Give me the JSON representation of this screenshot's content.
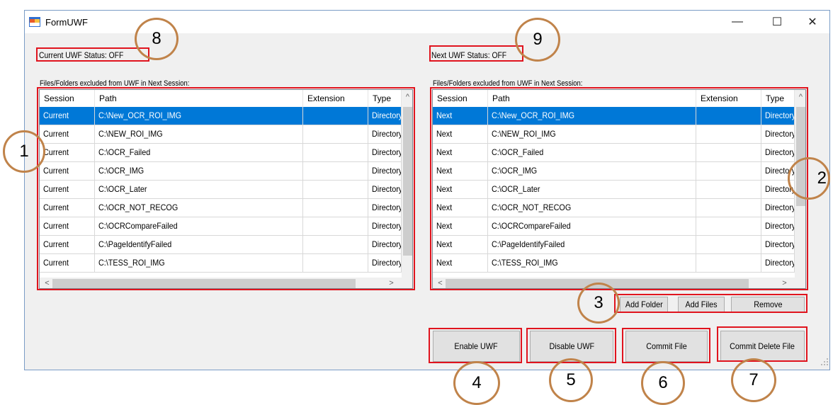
{
  "window": {
    "title": "FormUWF",
    "minimize": "—",
    "maximize": "☐",
    "close": "✕"
  },
  "left": {
    "status": "Current UWF Status: OFF",
    "list_label": "Files/Folders excluded from UWF in Next Session:",
    "columns": [
      "Session",
      "Path",
      "Extension",
      "Type"
    ],
    "rows": [
      [
        "Current",
        "C:\\New_OCR_ROI_IMG",
        "",
        "Directory"
      ],
      [
        "Current",
        "C:\\NEW_ROI_IMG",
        "",
        "Directory"
      ],
      [
        "Current",
        "C:\\OCR_Failed",
        "",
        "Directory"
      ],
      [
        "Current",
        "C:\\OCR_IMG",
        "",
        "Directory"
      ],
      [
        "Current",
        "C:\\OCR_Later",
        "",
        "Directory"
      ],
      [
        "Current",
        "C:\\OCR_NOT_RECOG",
        "",
        "Directory"
      ],
      [
        "Current",
        "C:\\OCRCompareFailed",
        "",
        "Directory"
      ],
      [
        "Current",
        "C:\\PageIdentifyFailed",
        "",
        "Directory"
      ],
      [
        "Current",
        "C:\\TESS_ROI_IMG",
        "",
        "Directory"
      ]
    ],
    "selected_index": 0
  },
  "right": {
    "status": "Next UWF Status: OFF",
    "list_label": "Files/Folders excluded from UWF in Next Session:",
    "columns": [
      "Session",
      "Path",
      "Extension",
      "Type"
    ],
    "rows": [
      [
        "Next",
        "C:\\New_OCR_ROI_IMG",
        "",
        "Directory"
      ],
      [
        "Next",
        "C:\\NEW_ROI_IMG",
        "",
        "Directory"
      ],
      [
        "Next",
        "C:\\OCR_Failed",
        "",
        "Directory"
      ],
      [
        "Next",
        "C:\\OCR_IMG",
        "",
        "Directory"
      ],
      [
        "Next",
        "C:\\OCR_Later",
        "",
        "Directory"
      ],
      [
        "Next",
        "C:\\OCR_NOT_RECOG",
        "",
        "Directory"
      ],
      [
        "Next",
        "C:\\OCRCompareFailed",
        "",
        "Directory"
      ],
      [
        "Next",
        "C:\\PageIdentifyFailed",
        "",
        "Directory"
      ],
      [
        "Next",
        "C:\\TESS_ROI_IMG",
        "",
        "Directory"
      ]
    ],
    "selected_index": 0
  },
  "buttons": {
    "add_folder": "Add Folder",
    "add_files": "Add Files",
    "remove": "Remove",
    "enable": "Enable UWF",
    "disable": "Disable UWF",
    "commit_file": "Commit File",
    "commit_delete": "Commit Delete File"
  },
  "annotations": [
    "1",
    "2",
    "3",
    "4",
    "5",
    "6",
    "7",
    "8",
    "9"
  ],
  "colors": {
    "highlight_box": "#e0141e",
    "annotation_circle": "#c0834a",
    "selection": "#0078d7"
  }
}
